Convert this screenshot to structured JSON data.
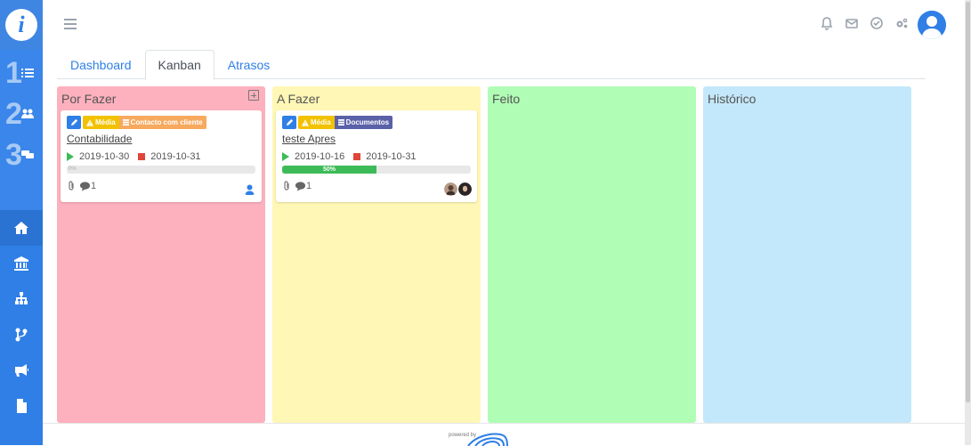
{
  "nav": {
    "steps": [
      "1",
      "2",
      "3"
    ],
    "icons": [
      "home-icon",
      "bank-icon",
      "sitemap-icon",
      "branch-icon",
      "megaphone-icon",
      "file-icon"
    ]
  },
  "logo": {
    "letter": "i"
  },
  "tabs": [
    {
      "label": "Dashboard",
      "active": false
    },
    {
      "label": "Kanban",
      "active": true
    },
    {
      "label": "Atrasos",
      "active": false
    }
  ],
  "columns": [
    {
      "title": "Por Fazer",
      "color": "#fdb0bd",
      "cards": [
        {
          "priority": "Média",
          "category": "Contacto com cliente",
          "category_color": "#f7a95e",
          "title": "Contabilidade",
          "start": "2019-10-30",
          "end": "2019-10-31",
          "progress": 0,
          "progress_label": "0%",
          "comments": "1"
        }
      ]
    },
    {
      "title": "A Fazer",
      "color": "#fff7b5",
      "cards": [
        {
          "priority": "Média",
          "category": "Documentos",
          "category_color": "#5a61a8",
          "title": "teste Apres",
          "start": "2019-10-16",
          "end": "2019-10-31",
          "progress": 50,
          "progress_label": "50%",
          "comments": "1"
        }
      ]
    },
    {
      "title": "Feito",
      "color": "#b0fdb5",
      "cards": []
    },
    {
      "title": "Histórico",
      "color": "#c4e8fb",
      "cards": []
    }
  ],
  "footer": {
    "powered": "powered by"
  },
  "colors": {
    "accent": "#2f7fe6",
    "sidebar": "#2f7fe6",
    "success": "#3dbb58",
    "danger": "#e0453a",
    "warning": "#f2c200"
  }
}
